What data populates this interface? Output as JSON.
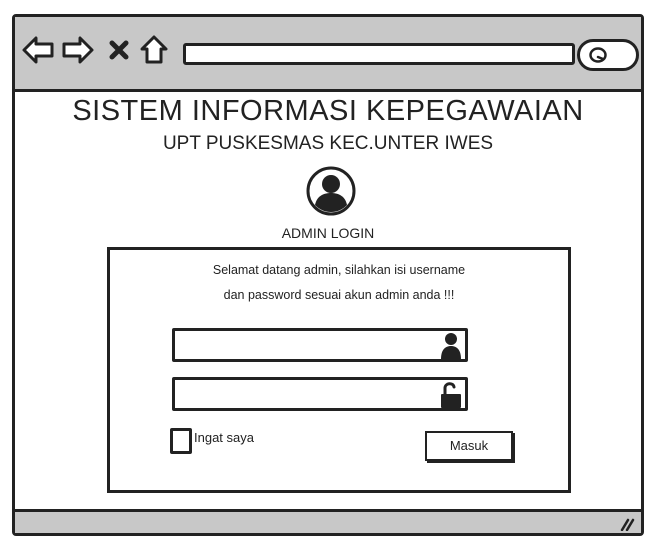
{
  "browser": {
    "nav_icons": [
      "back-arrow-icon",
      "forward-arrow-icon",
      "close-x-icon",
      "home-icon"
    ],
    "url": "",
    "search_icon": "search-icon"
  },
  "page": {
    "title": "SISTEM INFORMASI KEPEGAWAIAN",
    "subtitle": "UPT PUSKESMAS KEC.UNTER IWES",
    "avatar_icon": "user-avatar-icon",
    "login_label": "ADMIN LOGIN"
  },
  "login": {
    "welcome_line1": "Selamat datang admin, silahkan isi username",
    "welcome_line2": "dan password sesuai akun admin anda !!!",
    "username": {
      "value": "",
      "icon": "user-icon"
    },
    "password": {
      "value": "",
      "icon": "unlock-icon"
    },
    "remember_label": "Ingat saya",
    "remember_checked": false,
    "submit_label": "Masuk"
  },
  "colors": {
    "chrome": "#c8c8c8",
    "ink": "#222222",
    "background": "#ffffff"
  }
}
